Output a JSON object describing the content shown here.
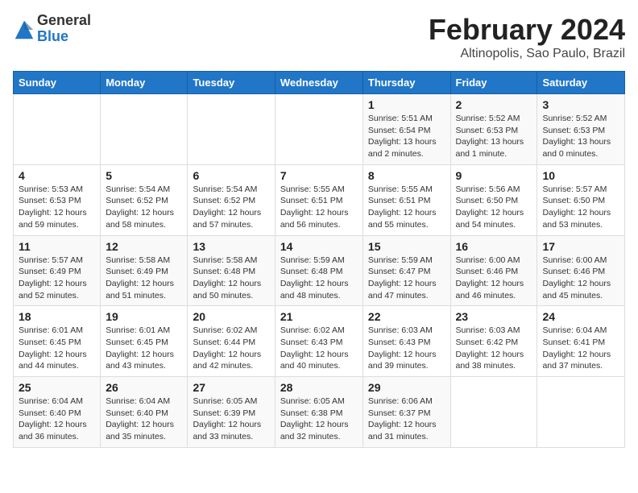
{
  "header": {
    "logo_text_top": "General",
    "logo_text_bottom": "Blue",
    "title": "February 2024",
    "subtitle": "Altinopolis, Sao Paulo, Brazil"
  },
  "calendar": {
    "days_of_week": [
      "Sunday",
      "Monday",
      "Tuesday",
      "Wednesday",
      "Thursday",
      "Friday",
      "Saturday"
    ],
    "weeks": [
      [
        {
          "day": "",
          "info": ""
        },
        {
          "day": "",
          "info": ""
        },
        {
          "day": "",
          "info": ""
        },
        {
          "day": "",
          "info": ""
        },
        {
          "day": "1",
          "info": "Sunrise: 5:51 AM\nSunset: 6:54 PM\nDaylight: 13 hours\nand 2 minutes."
        },
        {
          "day": "2",
          "info": "Sunrise: 5:52 AM\nSunset: 6:53 PM\nDaylight: 13 hours\nand 1 minute."
        },
        {
          "day": "3",
          "info": "Sunrise: 5:52 AM\nSunset: 6:53 PM\nDaylight: 13 hours\nand 0 minutes."
        }
      ],
      [
        {
          "day": "4",
          "info": "Sunrise: 5:53 AM\nSunset: 6:53 PM\nDaylight: 12 hours\nand 59 minutes."
        },
        {
          "day": "5",
          "info": "Sunrise: 5:54 AM\nSunset: 6:52 PM\nDaylight: 12 hours\nand 58 minutes."
        },
        {
          "day": "6",
          "info": "Sunrise: 5:54 AM\nSunset: 6:52 PM\nDaylight: 12 hours\nand 57 minutes."
        },
        {
          "day": "7",
          "info": "Sunrise: 5:55 AM\nSunset: 6:51 PM\nDaylight: 12 hours\nand 56 minutes."
        },
        {
          "day": "8",
          "info": "Sunrise: 5:55 AM\nSunset: 6:51 PM\nDaylight: 12 hours\nand 55 minutes."
        },
        {
          "day": "9",
          "info": "Sunrise: 5:56 AM\nSunset: 6:50 PM\nDaylight: 12 hours\nand 54 minutes."
        },
        {
          "day": "10",
          "info": "Sunrise: 5:57 AM\nSunset: 6:50 PM\nDaylight: 12 hours\nand 53 minutes."
        }
      ],
      [
        {
          "day": "11",
          "info": "Sunrise: 5:57 AM\nSunset: 6:49 PM\nDaylight: 12 hours\nand 52 minutes."
        },
        {
          "day": "12",
          "info": "Sunrise: 5:58 AM\nSunset: 6:49 PM\nDaylight: 12 hours\nand 51 minutes."
        },
        {
          "day": "13",
          "info": "Sunrise: 5:58 AM\nSunset: 6:48 PM\nDaylight: 12 hours\nand 50 minutes."
        },
        {
          "day": "14",
          "info": "Sunrise: 5:59 AM\nSunset: 6:48 PM\nDaylight: 12 hours\nand 48 minutes."
        },
        {
          "day": "15",
          "info": "Sunrise: 5:59 AM\nSunset: 6:47 PM\nDaylight: 12 hours\nand 47 minutes."
        },
        {
          "day": "16",
          "info": "Sunrise: 6:00 AM\nSunset: 6:46 PM\nDaylight: 12 hours\nand 46 minutes."
        },
        {
          "day": "17",
          "info": "Sunrise: 6:00 AM\nSunset: 6:46 PM\nDaylight: 12 hours\nand 45 minutes."
        }
      ],
      [
        {
          "day": "18",
          "info": "Sunrise: 6:01 AM\nSunset: 6:45 PM\nDaylight: 12 hours\nand 44 minutes."
        },
        {
          "day": "19",
          "info": "Sunrise: 6:01 AM\nSunset: 6:45 PM\nDaylight: 12 hours\nand 43 minutes."
        },
        {
          "day": "20",
          "info": "Sunrise: 6:02 AM\nSunset: 6:44 PM\nDaylight: 12 hours\nand 42 minutes."
        },
        {
          "day": "21",
          "info": "Sunrise: 6:02 AM\nSunset: 6:43 PM\nDaylight: 12 hours\nand 40 minutes."
        },
        {
          "day": "22",
          "info": "Sunrise: 6:03 AM\nSunset: 6:43 PM\nDaylight: 12 hours\nand 39 minutes."
        },
        {
          "day": "23",
          "info": "Sunrise: 6:03 AM\nSunset: 6:42 PM\nDaylight: 12 hours\nand 38 minutes."
        },
        {
          "day": "24",
          "info": "Sunrise: 6:04 AM\nSunset: 6:41 PM\nDaylight: 12 hours\nand 37 minutes."
        }
      ],
      [
        {
          "day": "25",
          "info": "Sunrise: 6:04 AM\nSunset: 6:40 PM\nDaylight: 12 hours\nand 36 minutes."
        },
        {
          "day": "26",
          "info": "Sunrise: 6:04 AM\nSunset: 6:40 PM\nDaylight: 12 hours\nand 35 minutes."
        },
        {
          "day": "27",
          "info": "Sunrise: 6:05 AM\nSunset: 6:39 PM\nDaylight: 12 hours\nand 33 minutes."
        },
        {
          "day": "28",
          "info": "Sunrise: 6:05 AM\nSunset: 6:38 PM\nDaylight: 12 hours\nand 32 minutes."
        },
        {
          "day": "29",
          "info": "Sunrise: 6:06 AM\nSunset: 6:37 PM\nDaylight: 12 hours\nand 31 minutes."
        },
        {
          "day": "",
          "info": ""
        },
        {
          "day": "",
          "info": ""
        }
      ]
    ]
  }
}
